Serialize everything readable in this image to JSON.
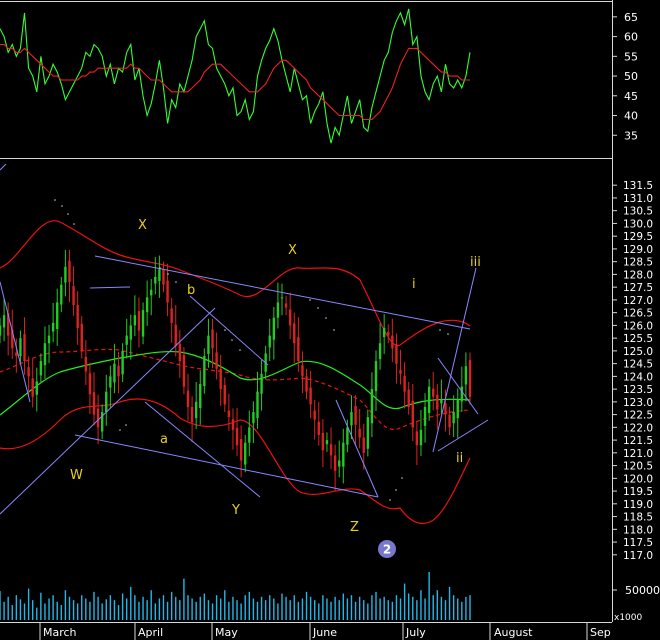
{
  "colors": {
    "background": "#000000",
    "frame": "#d8d8d8",
    "candle_up": "#22cc22",
    "candle_down": "#dd2222",
    "rsi_line": "#33ff33",
    "rsi_signal": "#ee2222",
    "bollinger": "#ee1111",
    "moving_average": "#22ee22",
    "channel": "#8888ff",
    "wave_label": "#e8d21a",
    "volume": "#20b8e8",
    "badge": "#7777cc"
  },
  "chart_data": [
    {
      "type": "line",
      "panel": "oscillator",
      "y_ticks": [
        "65",
        "60",
        "55",
        "50",
        "45",
        "40",
        "35"
      ],
      "ylim": [
        30,
        68
      ],
      "series": [
        {
          "values": [
            62,
            60,
            56,
            58,
            55,
            57,
            66,
            52,
            50,
            46,
            55,
            48,
            50,
            53,
            51,
            48,
            44,
            46,
            48,
            50,
            52,
            56,
            55,
            58,
            57,
            55,
            50,
            53,
            48,
            52,
            51,
            56,
            58,
            49,
            52,
            45,
            40,
            43,
            48,
            54,
            47,
            38,
            44,
            42,
            48,
            46,
            50,
            54,
            60,
            62,
            64,
            58,
            57,
            52,
            50,
            48,
            45,
            47,
            40,
            41,
            44,
            39,
            41,
            50,
            54,
            57,
            59,
            62,
            59,
            54,
            50,
            46,
            52,
            48,
            44,
            45,
            38,
            41,
            43,
            46,
            38,
            33,
            37,
            35,
            40,
            45,
            38,
            41,
            44,
            37,
            36,
            42,
            46,
            50,
            54,
            56,
            61,
            64,
            66,
            63,
            67,
            58,
            60,
            50,
            46,
            44,
            48,
            50,
            46,
            53,
            48,
            47,
            49,
            47,
            50,
            56
          ]
        },
        {
          "values": [
            58,
            58,
            57,
            57,
            56,
            56,
            57,
            56,
            55,
            54,
            53,
            52,
            51,
            50,
            50,
            49,
            49,
            49,
            49,
            49,
            50,
            50,
            51,
            51,
            52,
            52,
            52,
            52,
            52,
            52,
            52,
            52,
            53,
            52,
            52,
            51,
            50,
            49,
            49,
            49,
            48,
            47,
            46,
            46,
            46,
            46,
            46,
            47,
            48,
            49,
            51,
            52,
            53,
            53,
            53,
            52,
            51,
            50,
            49,
            48,
            47,
            46,
            46,
            46,
            47,
            48,
            50,
            52,
            53,
            54,
            54,
            53,
            52,
            51,
            50,
            49,
            47,
            46,
            45,
            44,
            43,
            42,
            41,
            40,
            40,
            40,
            40,
            40,
            40,
            39,
            39,
            39,
            40,
            41,
            43,
            45,
            47,
            50,
            53,
            55,
            57,
            57,
            57,
            56,
            55,
            54,
            53,
            52,
            51,
            51,
            50,
            50,
            50,
            49,
            49,
            49
          ]
        }
      ]
    },
    {
      "type": "candlestick",
      "panel": "price",
      "x_labels": [
        "March",
        "April",
        "May",
        "June",
        "July",
        "August",
        "Sep"
      ],
      "y_ticks": [
        "131.5",
        "131.0",
        "130.5",
        "130.0",
        "129.5",
        "129.0",
        "128.5",
        "128.0",
        "127.5",
        "127.0",
        "126.5",
        "126.0",
        "125.5",
        "125.0",
        "124.5",
        "124.0",
        "123.5",
        "123.0",
        "122.5",
        "122.0",
        "121.5",
        "121.0",
        "120.5",
        "120.0",
        "119.5",
        "119.0",
        "118.5",
        "118.0",
        "117.5",
        "117.0"
      ],
      "ylim": [
        116.6,
        131.9
      ],
      "closes": [
        126.0,
        126.4,
        125.6,
        125.1,
        124.8,
        125.5,
        124.6,
        124.0,
        123.2,
        123.8,
        124.6,
        125.3,
        125.6,
        126.1,
        126.9,
        127.6,
        128.3,
        127.7,
        126.8,
        125.9,
        125.0,
        124.2,
        123.3,
        122.5,
        122.0,
        122.6,
        123.4,
        124.0,
        124.5,
        124.0,
        125.0,
        125.6,
        126.0,
        126.4,
        125.8,
        126.6,
        127.1,
        127.4,
        127.9,
        128.2,
        127.6,
        126.9,
        126.1,
        125.2,
        124.6,
        123.6,
        122.8,
        122.2,
        123.0,
        123.7,
        124.8,
        125.6,
        125.1,
        124.3,
        123.5,
        122.9,
        122.4,
        121.9,
        121.3,
        120.7,
        121.4,
        122.0,
        122.6,
        123.4,
        124.1,
        124.9,
        125.6,
        126.3,
        126.9,
        127.1,
        126.7,
        126.0,
        125.3,
        124.6,
        124.0,
        123.4,
        122.9,
        122.3,
        121.7,
        121.1,
        121.5,
        120.9,
        120.3,
        120.7,
        121.4,
        122.0,
        122.6,
        122.1,
        121.6,
        121.0,
        122.4,
        123.5,
        124.6,
        125.3,
        125.9,
        125.6,
        125.1,
        124.5,
        124.1,
        123.4,
        122.8,
        122.0,
        121.3,
        121.9,
        122.8,
        123.6,
        123.2,
        122.7,
        123.1,
        122.5,
        122.0,
        122.6,
        123.1,
        123.6,
        124.4,
        123.2
      ]
    },
    {
      "type": "bar",
      "panel": "volume",
      "y_ticks": [
        "50000"
      ],
      "unit": "x1000",
      "values": [
        35,
        22,
        28,
        18,
        30,
        25,
        20,
        38,
        24,
        15,
        33,
        20,
        26,
        30,
        22,
        18,
        36,
        28,
        24,
        20,
        30,
        26,
        22,
        34,
        28,
        20,
        25,
        30,
        24,
        18,
        32,
        26,
        40,
        30,
        22,
        28,
        24,
        36,
        20,
        26,
        30,
        22,
        34,
        28,
        24,
        50,
        30,
        26,
        22,
        28,
        32,
        24,
        20,
        30,
        26,
        36,
        22,
        28,
        24,
        20,
        30,
        34,
        26,
        22,
        28,
        24,
        30,
        26,
        20,
        32,
        28,
        24,
        30,
        22,
        26,
        34,
        28,
        24,
        20,
        30,
        26,
        22,
        28,
        24,
        32,
        26,
        30,
        22,
        28,
        24,
        20,
        30,
        34,
        26,
        28,
        24,
        22,
        30,
        26,
        44,
        32,
        28,
        24,
        36,
        26,
        58,
        30,
        36,
        28,
        24,
        40,
        30,
        26,
        22,
        28,
        30
      ]
    }
  ],
  "annotations": {
    "wave_labels": [
      "X",
      "X",
      "b",
      "a",
      "W",
      "Y",
      "Z",
      "i",
      "iii",
      "ii"
    ],
    "badge": "2"
  }
}
